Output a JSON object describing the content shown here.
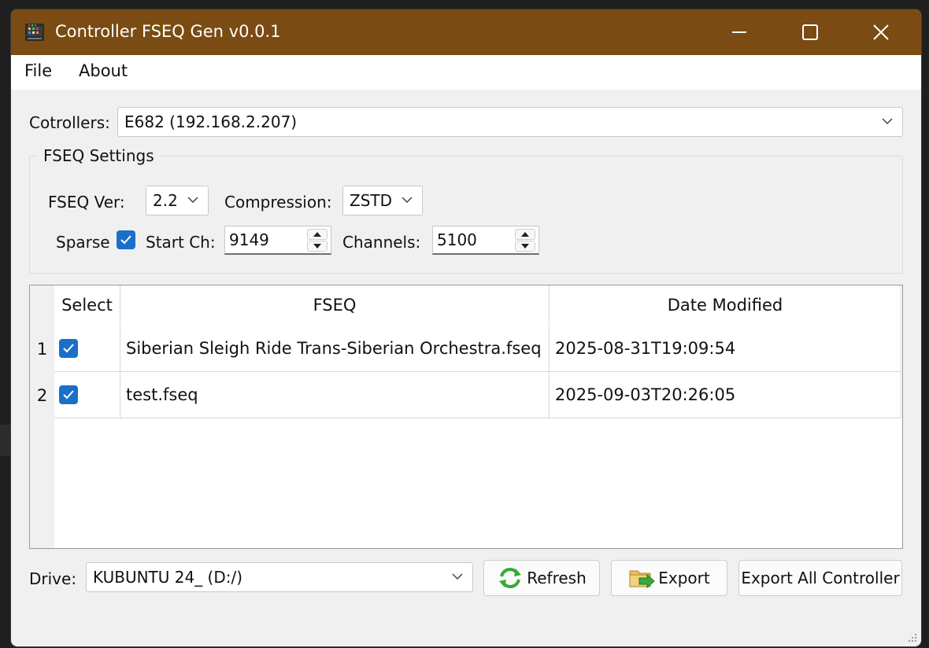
{
  "window": {
    "title": "Controller FSEQ Gen v0.0.1",
    "titlebar_color": "#7a4b12"
  },
  "menu": {
    "items": [
      "File",
      "About"
    ]
  },
  "controllers": {
    "label": "Cotrollers:",
    "selected": "E682 (192.168.2.207)"
  },
  "fseq_settings": {
    "group_title": "FSEQ Settings",
    "version_label": "FSEQ Ver:",
    "version_value": "2.2",
    "compression_label": "Compression:",
    "compression_value": "ZSTD",
    "sparse_label": "Sparse",
    "sparse_checked": true,
    "start_ch_label": "Start Ch:",
    "start_ch_value": "9149",
    "channels_label": "Channels:",
    "channels_value": "5100"
  },
  "table": {
    "headers": [
      "Select",
      "FSEQ",
      "Date Modified"
    ],
    "rows": [
      {
        "num": "1",
        "selected": true,
        "fseq": "Siberian Sleigh Ride  Trans-Siberian Orchestra.fseq",
        "date": "2025-08-31T19:09:54"
      },
      {
        "num": "2",
        "selected": true,
        "fseq": "test.fseq",
        "date": "2025-09-03T20:26:05"
      }
    ]
  },
  "drive": {
    "label": "Drive:",
    "selected": "KUBUNTU 24_ (D:/)"
  },
  "buttons": {
    "refresh": "Refresh",
    "export": "Export",
    "export_all": "Export All Controller"
  },
  "colors": {
    "accent": "#1a6fc8",
    "window_bg": "#f0f0f0"
  }
}
